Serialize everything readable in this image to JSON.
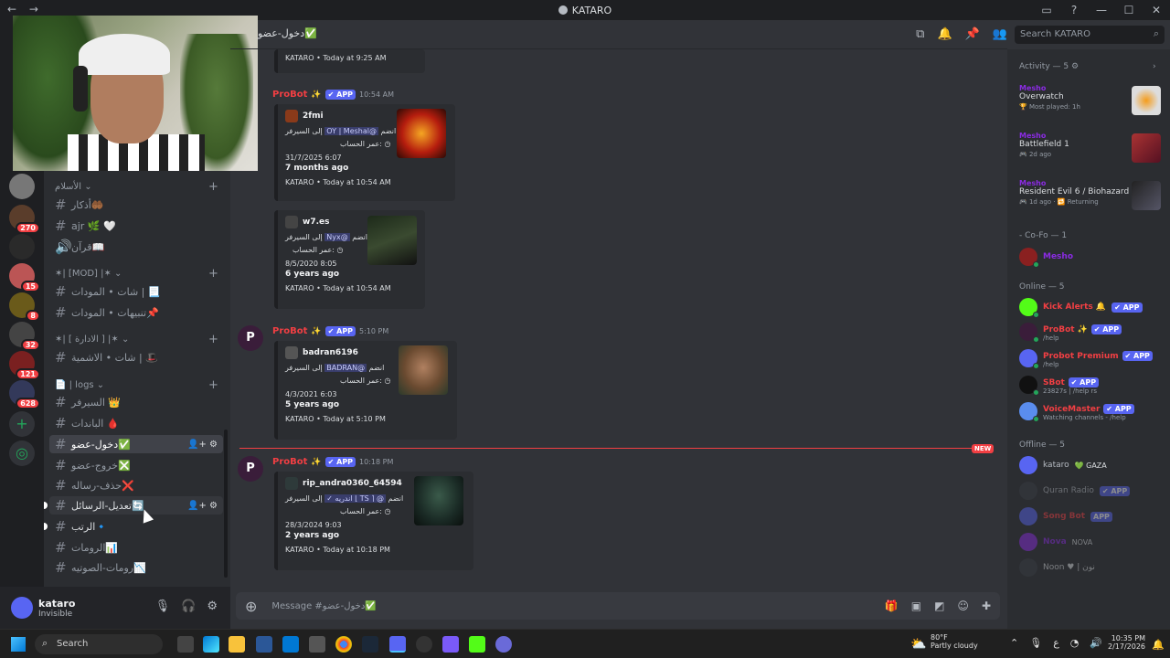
{
  "window": {
    "title": "KATARO",
    "back_icon": "←",
    "forward_icon": "→"
  },
  "guilds": {
    "badges": [
      "270",
      "15",
      "8",
      "32",
      "121",
      "628"
    ]
  },
  "channel_header": {
    "name": "دخول-عضو✅"
  },
  "search": {
    "placeholder": "Search KATARO"
  },
  "sidebar": {
    "categories": [
      {
        "label": "الأسلام ⌄"
      },
      {
        "label": "✶| [MOD] |✶ ⌄"
      },
      {
        "label": "✶| [ الادارة ] |✶ ⌄"
      },
      {
        "label": "📄 | logs ⌄"
      }
    ],
    "channels": [
      {
        "label": "أذكار🤲🏾"
      },
      {
        "label": "ajr 🌿 🤍"
      },
      {
        "label": "قرآن📖"
      },
      {
        "label": "شات • المودات | 📃"
      },
      {
        "label": "تنبيهات • المودات📌"
      },
      {
        "label": "شات • الاشمية | 🎩"
      },
      {
        "label": "السيرفر 👑"
      },
      {
        "label": "الباندات 🩸"
      },
      {
        "label": "دخول-عضو✅"
      },
      {
        "label": "خروج-عضو❎"
      },
      {
        "label": "حذف-رساله❌"
      },
      {
        "label": "تعديل-الرسائل🔄"
      },
      {
        "label": "الرتب🔹"
      },
      {
        "label": "الرومات📊"
      },
      {
        "label": "رومات-الصوتيه📉"
      }
    ]
  },
  "user_panel": {
    "name": "kataro",
    "status": "Invisible"
  },
  "messages": [
    {
      "footer": "KATARO • Today at 9:25 AM"
    },
    {
      "bot": "ProBot",
      "app": "APP",
      "time": "10:54 AM",
      "embeds": [
        {
          "user": "2fmi",
          "join_text": "انضم",
          "mention": "@OY | Meshal",
          "to_server": "إلى السيرفر",
          "age_label": "عمر الحساب:",
          "date": "31/7/2025 6:07",
          "ago": "7 months ago",
          "footer": "KATARO • Today at 10:54 AM"
        },
        {
          "user": "w7.es",
          "join_text": "انضم",
          "mention": "@Nyx",
          "to_server": "إلى السيرفر",
          "age_label": "عمر الحساب:",
          "date": "8/5/2020 8:05",
          "ago": "6 years ago",
          "footer": "KATARO • Today at 10:54 AM"
        }
      ]
    },
    {
      "bot": "ProBot",
      "app": "APP",
      "time": "5:10 PM",
      "embeds": [
        {
          "user": "badran6196",
          "join_text": "انضم",
          "mention": "@BADRAN",
          "to_server": "إلى السيرفر",
          "age_label": "عمر الحساب:",
          "date": "4/3/2021 6:03",
          "ago": "5 years ago",
          "footer": "KATARO • Today at 5:10 PM"
        }
      ]
    },
    {
      "bot": "ProBot",
      "app": "APP",
      "time": "10:18 PM",
      "new_tag": "NEW",
      "embeds": [
        {
          "user": "rip_andra0360_64594",
          "join_text": "انضم",
          "mention": "@ ⌈ TS ⌋ اندريه ✓",
          "to_server": "إلى السيرفر",
          "age_label": "عمر الحساب:",
          "date": "28/3/2024 9:03",
          "ago": "2 years ago",
          "footer": "KATARO • Today at 10:18 PM"
        }
      ]
    }
  ],
  "composer": {
    "placeholder": "Message #دخول-عضو✅"
  },
  "activity": {
    "title": "Activity — 5",
    "items": [
      {
        "user": "Mesho",
        "game": "Overwatch",
        "sub": "🏆 Most played: 1h"
      },
      {
        "user": "Mesho",
        "game": "Battlefield 1",
        "sub": "🎮 2d ago"
      },
      {
        "user": "Mesho",
        "game": "Resident Evil 6 / Biohazard 6",
        "sub": "🎮 1d ago · 🔁 Returning"
      }
    ]
  },
  "members": {
    "co_fo_title": "- Co-Fo — 1",
    "co_fo": [
      {
        "name": "Mesho"
      }
    ],
    "online_title": "Online — 5",
    "online": [
      {
        "name": "Kick Alerts 🔔",
        "tag": "APP",
        "sub": ""
      },
      {
        "name": "ProBot ✨",
        "tag": "APP",
        "sub": "/help"
      },
      {
        "name": "Probot Premium",
        "tag": "APP",
        "sub": "/help"
      },
      {
        "name": "SBot",
        "tag": "APP",
        "sub": "23827s | /help rs"
      },
      {
        "name": "VoiceMaster",
        "tag": "APP",
        "sub": "Watching channels - /help"
      }
    ],
    "offline_title": "Offline — 5",
    "offline": [
      {
        "name": "kataro",
        "tag": "💚 GAZA"
      },
      {
        "name": "Quran Radio",
        "tag": "APP"
      },
      {
        "name": "Song Bot",
        "tag": "APP"
      },
      {
        "name": "Nova",
        "tag": "NOVA"
      },
      {
        "name": "Noon ♥ | نون",
        "tag": ""
      }
    ]
  },
  "taskbar": {
    "search_label": "Search",
    "weather_temp": "80°F",
    "weather_desc": "Partly cloudy",
    "time": "10:35 PM",
    "date": "2/17/2026",
    "lang": "ع"
  },
  "colors": {
    "accent": "#5865f2",
    "danger": "#f23f43",
    "online": "#23a55a"
  }
}
